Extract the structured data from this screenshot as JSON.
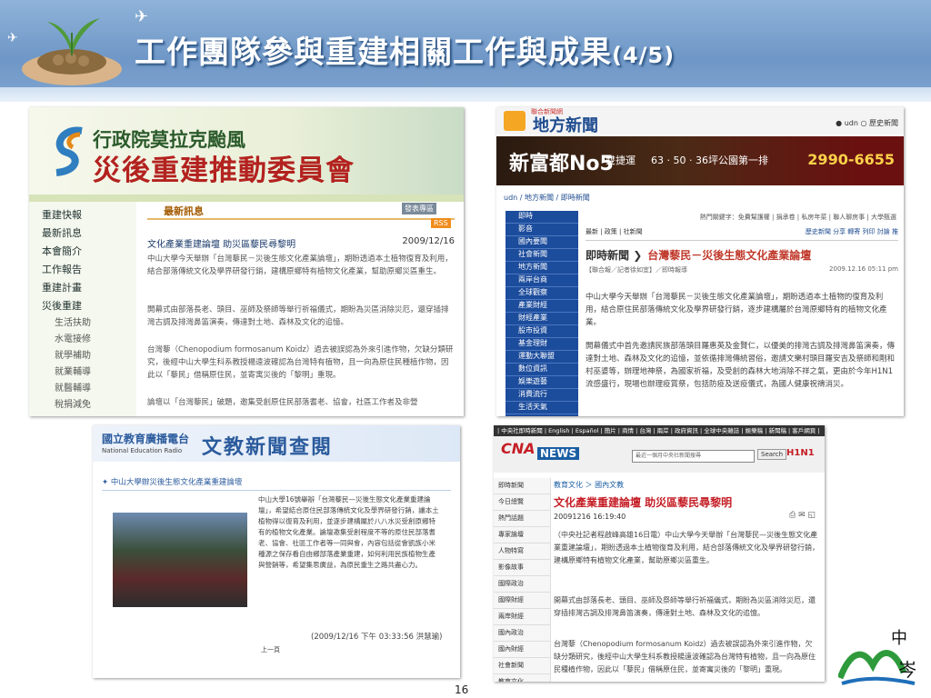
{
  "slide": {
    "title": "工作團隊參與重建相關工作與成果",
    "title_suffix": "(4/5)",
    "page_number": "16"
  },
  "panel1": {
    "org_line1": "行政院莫拉克颱風",
    "org_line2": "災後重建推動委員會",
    "menu": [
      "重建快報",
      "最新訊息",
      "本會簡介",
      "工作報告",
      "重建計畫",
      "災後重建"
    ],
    "submenu": [
      "生活扶助",
      "水電接修",
      "就學補助",
      "就業輔導",
      "就醫輔導",
      "稅捐減免"
    ],
    "news_header": "最新訊息",
    "btn_publish": "發表專區",
    "btn_rss": "RSS",
    "headline": "文化產業重建論壇 助災區藜民尋黎明",
    "date": "2009/12/16",
    "paragraphs": [
      "中山大學今天舉辦「台灣藜民－災後生態文化產業論壇」，期盼透過本土植物復育及利用，結合部落傳統文化及學界研發行銷，建構原鄉特有植物文化產業，幫助原鄉災區重生。",
      "開幕式由部落長老、頭目、巫師及祭師等舉行祈福儀式，期盼為災區消除災厄，還穿插排灣古調及排灣鼻笛演奏，傳達對土地、森林及文化的追憶。",
      "台灣藜（Chenopodium formosanum Koidz）過去被誤認為外來引進作物，欠缺分類研究，後經中山大學生科系教授楊遠波確認為台灣特有植物，且一向為原住民種植作物，因此以「藜民」借稱原住民，並寄寓災後的「黎明」重現。",
      "論壇以「台灣藜民」破題，邀集受創原住民部落耆老、協會，社區工作者及非營"
    ]
  },
  "panel2": {
    "brand_small": "聯合新聞網",
    "brand": "地方新聞",
    "radio_a": "udn",
    "radio_b": "歷史新聞",
    "ad_name": "新富都No5",
    "ad_tag": "雙捷運",
    "ad_spec": "63 · 50 · 36坪公園第一排",
    "ad_phone": "2990-6655",
    "breadcrumb": "udn / 地方新聞 / 即時新聞",
    "nav": [
      "即時",
      "影音",
      "國內要聞",
      "社會新聞",
      "地方新聞",
      "兩岸台商",
      "全球觀察",
      "產業財經",
      "財經產業",
      "股市投資",
      "基金理財",
      "運動大聯盟",
      "數位資訊",
      "娛樂遊藝",
      "消費流行",
      "生活天氣"
    ],
    "keywords": "熱門關鍵字：免費幫護權 | 捐承卷 | 私房年菜 | 聯人聊房事 | 大學甄選",
    "tabs_left": "最新 | 政策 | 社新聞",
    "tabs_right": "歷史新聞 分享 轉寄 列印 討論 推",
    "section": "即時新聞",
    "headline": "台灣藜民－災後生態文化產業論壇",
    "source": "【聯合報／記者徐如宜】／即時報導",
    "timestamp": "2009.12.16 05:11 pm",
    "paragraphs": [
      "中山大學今天舉辦「台灣藜民－災後生態文化產業論壇」，期盼透過本土植物的復育及利用，結合原住民部落傳統文化及學界研發行銷，逐步建構屬於台灣原鄉特有的植物文化產業。",
      "開幕儀式中首先邀請民族部落頭目羅惠英及金賢仁，以優美的排灣古調及排灣鼻笛演奏，傳達對土地、森林及文化的追憶，並依循排灣傳統習俗，邀請文樂村頭目羅安吉及祭師和剛和村巫婆等，辦理地神祭，為國家祈福，及受創的森林大地消除不祥之氣，更由於今年H1N1流感盛行，現場也辦理疫賞祭，包括防疫及送疫儀式，為國人健康祝禱消災。"
    ]
  },
  "panel3": {
    "station": "國立教育廣播電台",
    "station_en": "National Education Radio",
    "section": "文教新聞查閱",
    "headline": "中山大學辦災後生態文化產業重建論壇",
    "body": "中山大學16號舉辦「台灣藜民—災後生態文化產業重建論壇」，希望結合原住民部落傳統文化及學界研發行銷，讓本土植物得以復育及利用，並逐步建構屬於八八水災受創原鄉特有的植物文化產業。論壇邀集受創程度不等的原住民部落耆老、協會、社區工作者等一同與會，內容包括從會凱族小米種源之保存看自由鄉部落產業重建，如何利用民族植物生產與營銷等，希望集思廣益，為原民重生之路共盡心力。",
    "timestamp": "(2009/12/16 下午 03:33:56  洪慧瑜)",
    "prev": "上一頁"
  },
  "panel4": {
    "top_links": "| 中央社即時新聞 | English | Español | 簡片 | 商情 | 台灣 | 兩岸 | 政府資訊 | 全球中央雜誌 | 娛樂稿 | 新聞稿 | 客戶網頁 |",
    "brand": "CNA",
    "brand_sub": "即時新聞",
    "news": "NEWS",
    "search_placeholder": "最近一個月中央社新聞搜尋",
    "search_btn": "Search",
    "hot": "H1N1",
    "nav": [
      "即時新聞",
      "今日總覽",
      "熱門話題",
      "專家論壇",
      "人物特寫",
      "影像故事",
      "國際政治",
      "國際財經",
      "兩岸財經",
      "國內政治",
      "國內財經",
      "社會新聞",
      "教育文化"
    ],
    "category": "教育文化 ＞ 國內文教",
    "headline": "文化產業重建論壇 助災區藜民尋黎明",
    "datetime": "20091216 16:19:40",
    "paragraphs": [
      "（中央社記者程啟峰高雄16日電）中山大學今天舉辦「台灣藜民—災後生態文化產業重建論壇」，期盼透過本土植物復育及利用，結合部落傳統文化及學界研發行銷，建構原鄉特有植物文化產業，幫助原鄉災區重生。",
      "開幕式由部落長老、頭目、巫師及祭師等舉行祈福儀式，期盼為災區消除災厄，還穿插排灣古調及排灣鼻笛演奏，傳達對土地、森林及文化的追憶。",
      "台灣藜（Chenopodium formosanum Koidz）過去被誤認為外來引進作物，欠缺分類研究，後經中山大學生科系教授楊遠波確認為台灣特有植物，且一向為原住民種植作物，因此以「藜民」借稱原住民，並寄寓災後的「黎明」重現。"
    ]
  },
  "colors": {
    "header": "#6f97c7",
    "udn_blue": "#1c4c9c",
    "cna_red": "#c51e26",
    "ner_blue": "#2b5b9d"
  }
}
